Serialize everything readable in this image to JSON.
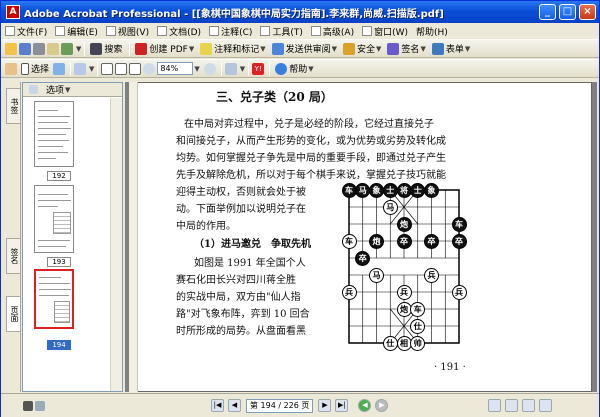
{
  "window": {
    "title": "Adobe Acrobat Professional - [[象棋中国象棋中局实力指南].李来群,尚威.扫描版.pdf]",
    "app_badge": "A",
    "minimize": "_",
    "maximize": "□",
    "close": "×"
  },
  "menu": [
    {
      "label": "文件(F)"
    },
    {
      "label": "编辑(E)"
    },
    {
      "label": "视图(V)"
    },
    {
      "label": "文档(D)"
    },
    {
      "label": "注释(C)"
    },
    {
      "label": "工具(T)"
    },
    {
      "label": "高级(A)"
    },
    {
      "label": "窗口(W)"
    },
    {
      "label": "帮助(H)"
    }
  ],
  "toolbar1": {
    "search_label": "搜索",
    "create_pdf": "创建 PDF",
    "comment_markup": "注释和标记",
    "send_review": "发送供审阅",
    "security": "安全",
    "sign": "签名",
    "forms": "表单"
  },
  "toolbar2": {
    "select_label": "选择",
    "zoom_value": "84%",
    "help_label": "帮助"
  },
  "nav_tabs": {
    "bookmarks": "书签",
    "signatures": "签名",
    "pages": "页面"
  },
  "thumbs": {
    "options_label": "选项",
    "labels": [
      "192",
      "193",
      "194"
    ]
  },
  "document": {
    "heading": "三、兑子类（20 局）",
    "lines": [
      "在中局对弈过程中，兑子是必经的阶段，它经过直接兑子",
      "和间接兑子，从而产生形势的变化，或为优势或劣势及转化成",
      "均势。如何掌握兑子争先是中局的重要手段，即通过兑子产生",
      "先手及解除危机，所以对于每个棋手来说，掌握兑子技巧就能",
      "迎得主动权，否则就会处于被",
      "动。下面举例加以说明兑子在",
      "中局的作用。",
      "（1）进马邀兑　争取先机",
      "如图是 1991 年全国个人",
      "赛石化田长兴对四川蒋全胜",
      "的实战中局，双方由\"仙人指",
      "路\"对飞象布阵，弈到 10 回合",
      "时所形成的局势。从盘面看黑"
    ],
    "page_number": "· 191 ·"
  },
  "board_pieces": [
    {
      "t": "车",
      "side": "black"
    },
    {
      "t": "马",
      "side": "black"
    },
    {
      "t": "象",
      "side": "black"
    },
    {
      "t": "士",
      "side": "black"
    },
    {
      "t": "将",
      "side": "black"
    },
    {
      "t": "士",
      "side": "black"
    },
    {
      "t": "象",
      "side": "black"
    },
    {
      "t": "马",
      "side": "red"
    },
    {
      "t": "炮",
      "side": "black"
    },
    {
      "t": "车",
      "side": "black"
    },
    {
      "t": "车",
      "side": "red"
    },
    {
      "t": "炮",
      "side": "black"
    },
    {
      "t": "卒",
      "side": "black"
    },
    {
      "t": "卒",
      "side": "black"
    },
    {
      "t": "卒",
      "side": "black"
    },
    {
      "t": "卒",
      "side": "black"
    },
    {
      "t": "马",
      "side": "red"
    },
    {
      "t": "兵",
      "side": "red"
    },
    {
      "t": "兵",
      "side": "red"
    },
    {
      "t": "兵",
      "side": "red"
    },
    {
      "t": "兵",
      "side": "red"
    },
    {
      "t": "炮",
      "side": "red"
    },
    {
      "t": "车",
      "side": "red"
    },
    {
      "t": "相",
      "side": "red"
    },
    {
      "t": "仕",
      "side": "red"
    },
    {
      "t": "帅",
      "side": "red"
    },
    {
      "t": "仕",
      "side": "red"
    }
  ],
  "status": {
    "page_indicator": "第 194 / 226 页"
  }
}
